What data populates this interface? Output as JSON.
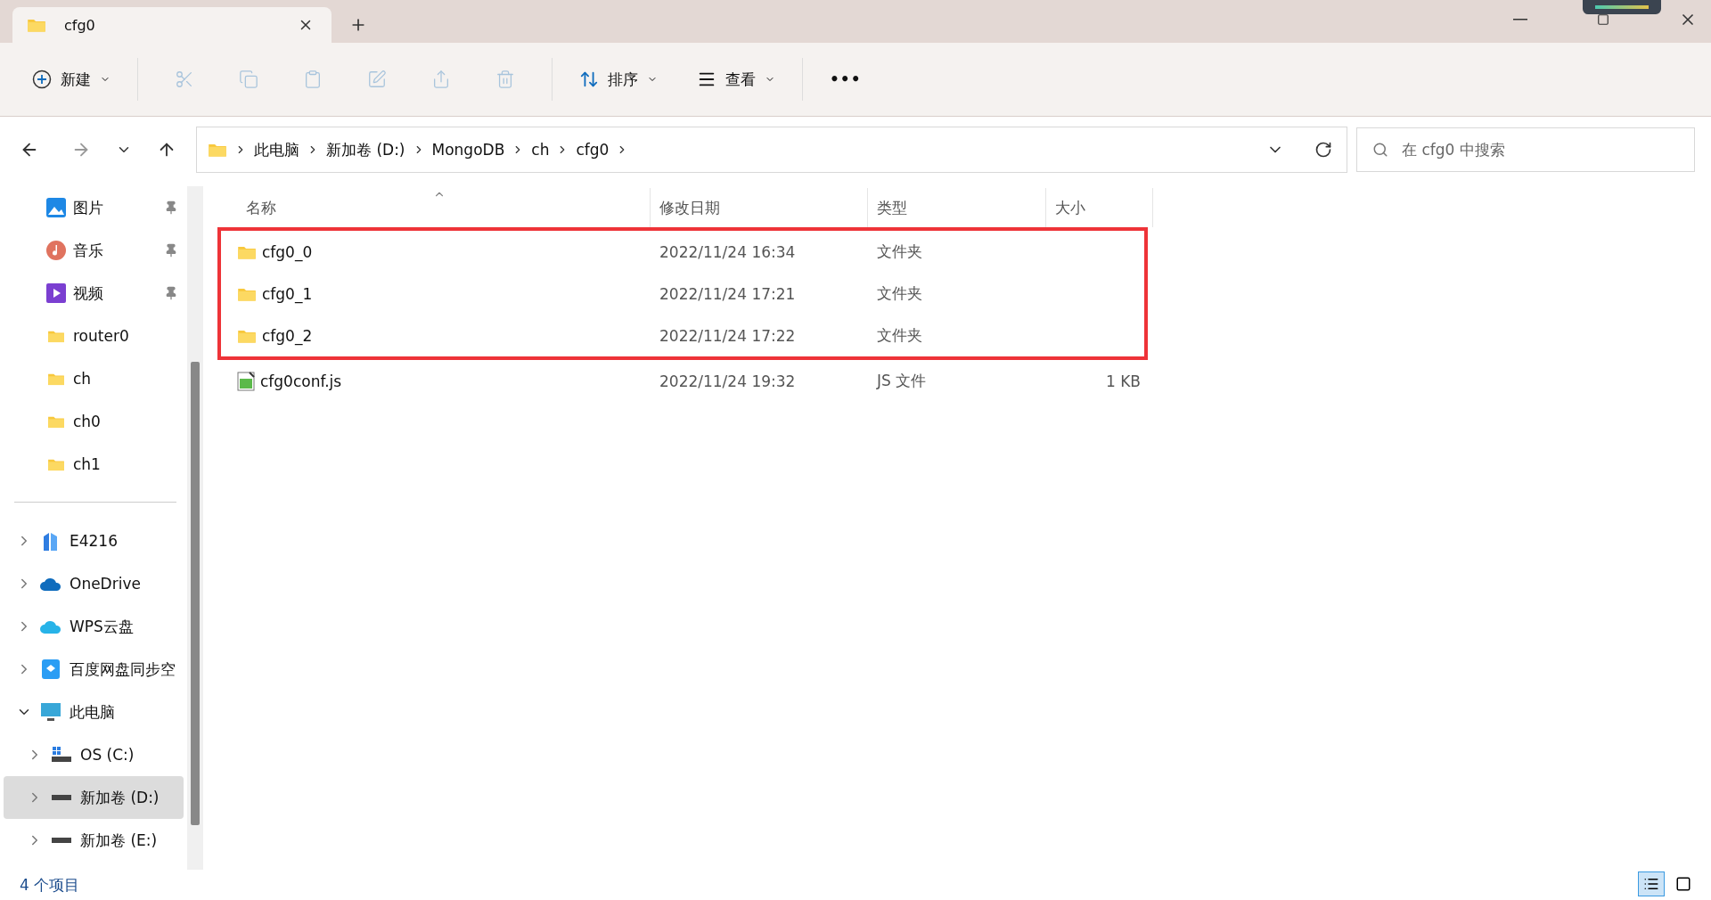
{
  "tabs": [
    {
      "label": "cfg0",
      "selected": true
    }
  ],
  "toolbar": {
    "new_label": "新建",
    "sort_label": "排序",
    "view_label": "查看",
    "more": "•••"
  },
  "address": {
    "segments": [
      "此电脑",
      "新加卷 (D:)",
      "MongoDB",
      "ch",
      "cfg0"
    ]
  },
  "search": {
    "placeholder": "在 cfg0 中搜索"
  },
  "quick_access": [
    {
      "label": "图片",
      "kind": "pictures",
      "pinned": true
    },
    {
      "label": "音乐",
      "kind": "music",
      "pinned": true
    },
    {
      "label": "视频",
      "kind": "videos",
      "pinned": true
    },
    {
      "label": "router0",
      "kind": "folder",
      "pinned": false
    },
    {
      "label": "ch",
      "kind": "folder",
      "pinned": false
    },
    {
      "label": "ch0",
      "kind": "folder",
      "pinned": false
    },
    {
      "label": "ch1",
      "kind": "folder",
      "pinned": false
    }
  ],
  "tree": [
    {
      "label": "E4216",
      "kind": "building",
      "expanded": false,
      "selected": false
    },
    {
      "label": "OneDrive",
      "kind": "cloud",
      "expanded": false,
      "selected": false
    },
    {
      "label": "WPS云盘",
      "kind": "cloud2",
      "expanded": false,
      "selected": false
    },
    {
      "label": "百度网盘同步空",
      "kind": "sync",
      "expanded": false,
      "selected": false
    },
    {
      "label": "此电脑",
      "kind": "computer",
      "expanded": true,
      "selected": false,
      "children": [
        {
          "label": "OS (C:)",
          "kind": "osdrive",
          "expanded": false,
          "selected": false
        },
        {
          "label": "新加卷 (D:)",
          "kind": "drive",
          "expanded": false,
          "selected": true
        },
        {
          "label": "新加卷 (E:)",
          "kind": "drive",
          "expanded": false,
          "selected": false
        }
      ]
    }
  ],
  "table": {
    "columns": [
      "名称",
      "修改日期",
      "类型",
      "大小"
    ],
    "rows": [
      {
        "name": "cfg0_0",
        "date": "2022/11/24 16:34",
        "type": "文件夹",
        "kind": "folder",
        "annotated": true
      },
      {
        "name": "cfg0_1",
        "date": "2022/11/24 17:21",
        "type": "文件夹",
        "kind": "folder",
        "annotated": true
      },
      {
        "name": "cfg0_2",
        "date": "2022/11/24 17:22",
        "type": "文件夹",
        "kind": "folder",
        "annotated": true
      },
      {
        "name": "cfg0conf.js",
        "date": "2022/11/24 19:32",
        "type": "JS 文件",
        "size": "1 KB",
        "kind": "script",
        "annotated": false
      }
    ]
  },
  "status_bar": {
    "count": "4 个项目"
  }
}
